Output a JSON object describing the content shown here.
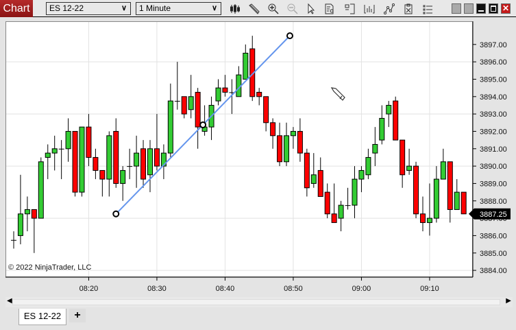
{
  "toolbar": {
    "chart_label": "Chart",
    "instrument": "ES 12-22",
    "interval": "1 Minute",
    "icons": [
      "bar-type-icon",
      "drawing-tool-icon",
      "zoom-in-icon",
      "zoom-out-icon",
      "pointer-icon",
      "data-box-icon",
      "templates-icon",
      "indicators-icon",
      "strategies-icon",
      "properties-icon",
      "list-icon"
    ]
  },
  "chart_data": {
    "type": "candlestick",
    "title": "",
    "instrument": "ES 12-22",
    "interval": "1 Minute",
    "start_time": "08:09",
    "ylim": [
      3883.55,
      3898.4
    ],
    "grid": true,
    "y_ticks": [
      "3897.00",
      "3896.00",
      "3895.00",
      "3894.00",
      "3893.00",
      "3892.00",
      "3891.00",
      "3890.00",
      "3889.00",
      "3888.00",
      "3887.00",
      "3886.00",
      "3885.00",
      "3884.00"
    ],
    "x_ticks": [
      "08:20",
      "08:30",
      "08:40",
      "08:50",
      "09:00",
      "09:10"
    ],
    "current_price": "3887.25",
    "colors": {
      "up": "#33cc33",
      "down": "#ff0000",
      "line": "#6495ed"
    },
    "candles": [
      [
        3885.75,
        3886.25,
        3885.25,
        3885.75
      ],
      [
        3886,
        3889.5,
        3885.5,
        3887.25
      ],
      [
        3887.25,
        3888.25,
        3886.25,
        3887.5
      ],
      [
        3887.5,
        3887.5,
        3885,
        3887
      ],
      [
        3887,
        3890.5,
        3887,
        3890.25
      ],
      [
        3890.5,
        3891.25,
        3889.25,
        3890.75
      ],
      [
        3890.75,
        3891.75,
        3889.75,
        3891
      ],
      [
        3891,
        3891.5,
        3889.25,
        3891
      ],
      [
        3891,
        3892.75,
        3890.25,
        3892
      ],
      [
        3892,
        3892,
        3888.25,
        3888.5
      ],
      [
        3888.5,
        3892.25,
        3888.25,
        3892.25
      ],
      [
        3892.25,
        3893,
        3890,
        3890.5
      ],
      [
        3890.5,
        3891,
        3889.25,
        3889.75
      ],
      [
        3889.75,
        3889.75,
        3888.25,
        3889.25
      ],
      [
        3889.25,
        3892,
        3888.25,
        3891.75
      ],
      [
        3892,
        3892.75,
        3888.75,
        3889
      ],
      [
        3889,
        3890,
        3888,
        3889.75
      ],
      [
        3890,
        3891,
        3889.25,
        3890
      ],
      [
        3890,
        3891.75,
        3888.75,
        3890.75
      ],
      [
        3891,
        3891.5,
        3888.75,
        3889.25
      ],
      [
        3889.5,
        3891.5,
        3888.5,
        3891
      ],
      [
        3891,
        3893,
        3889.75,
        3890
      ],
      [
        3890,
        3891.25,
        3889.25,
        3890.75
      ],
      [
        3890.75,
        3894.75,
        3890.5,
        3893.75
      ],
      [
        3893.75,
        3896,
        3893.25,
        3893.75
      ],
      [
        3894,
        3894,
        3892.75,
        3893
      ],
      [
        3893.25,
        3895.25,
        3892.75,
        3894
      ],
      [
        3894.25,
        3894.5,
        3891,
        3892.25
      ],
      [
        3892,
        3893.5,
        3891.75,
        3892.25
      ],
      [
        3892.25,
        3894,
        3891.5,
        3893.5
      ],
      [
        3893.75,
        3895,
        3893.5,
        3894.5
      ],
      [
        3894.5,
        3895.25,
        3894,
        3894.25
      ],
      [
        3894.25,
        3895,
        3893,
        3894.25
      ],
      [
        3894,
        3895.75,
        3894,
        3895.25
      ],
      [
        3895,
        3897,
        3895,
        3896.5
      ],
      [
        3896.75,
        3897.5,
        3893.75,
        3894
      ],
      [
        3894.25,
        3894.5,
        3893.5,
        3894
      ],
      [
        3894,
        3894,
        3892,
        3892.5
      ],
      [
        3892.5,
        3892.75,
        3891,
        3891.75
      ],
      [
        3891.75,
        3892.5,
        3890,
        3890.25
      ],
      [
        3890.25,
        3892.5,
        3890,
        3891.75
      ],
      [
        3891.75,
        3892.25,
        3891,
        3892
      ],
      [
        3892,
        3892.75,
        3890.25,
        3890.75
      ],
      [
        3890.75,
        3891,
        3888.25,
        3888.75
      ],
      [
        3889,
        3890.75,
        3888.75,
        3889.5
      ],
      [
        3889.75,
        3890.5,
        3888.25,
        3888.25
      ],
      [
        3888.5,
        3889,
        3887,
        3887.25
      ],
      [
        3887.25,
        3889,
        3886.75,
        3886.75
      ],
      [
        3887,
        3888,
        3886.25,
        3887.75
      ],
      [
        3887.75,
        3888.75,
        3887.5,
        3887.75
      ],
      [
        3887.75,
        3890,
        3887,
        3889.25
      ],
      [
        3889.25,
        3890,
        3888.5,
        3889.75
      ],
      [
        3889.5,
        3891,
        3889.25,
        3890.5
      ],
      [
        3890.75,
        3892.25,
        3890,
        3891.25
      ],
      [
        3891.5,
        3893.5,
        3891.25,
        3892.75
      ],
      [
        3893,
        3893.75,
        3892.25,
        3893.5
      ],
      [
        3893.75,
        3894,
        3891.5,
        3891.5
      ],
      [
        3891.5,
        3891.5,
        3888.75,
        3889.5
      ],
      [
        3889.75,
        3891,
        3889.5,
        3890
      ],
      [
        3890,
        3890.25,
        3887,
        3887.25
      ],
      [
        3887.25,
        3888.25,
        3886.25,
        3886.75
      ],
      [
        3886.75,
        3889,
        3886,
        3887
      ],
      [
        3887,
        3890,
        3886.75,
        3889.25
      ],
      [
        3889.25,
        3891,
        3889.25,
        3890.25
      ],
      [
        3890.25,
        3890.25,
        3886.75,
        3887.5
      ],
      [
        3887.5,
        3889.25,
        3887.5,
        3888.5
      ],
      [
        3888.5,
        3888.5,
        3887.25,
        3887.25
      ]
    ],
    "drawing_line": {
      "start": {
        "time": "08:24",
        "price": 3887.25
      },
      "end": {
        "time": "08:49:30",
        "price": 3897.5
      }
    }
  },
  "copyright": "© 2022 NinjaTrader, LLC",
  "bottom": {
    "tab_label": "ES 12-22",
    "add_tab_label": "+"
  }
}
